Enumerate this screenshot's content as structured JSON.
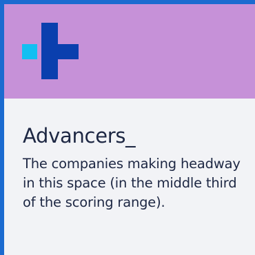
{
  "card": {
    "heading": "Advancers_",
    "description": "The companies making headway in this space (in the middle third of the scoring range)."
  },
  "icon": {
    "name": "plus-logo-icon"
  },
  "colors": {
    "border": "#1b6bd0",
    "band": "#c691d8",
    "logo_dark": "#0a3fae",
    "logo_light": "#12bff2",
    "text": "#1d2743",
    "background": "#f2f3f6"
  }
}
